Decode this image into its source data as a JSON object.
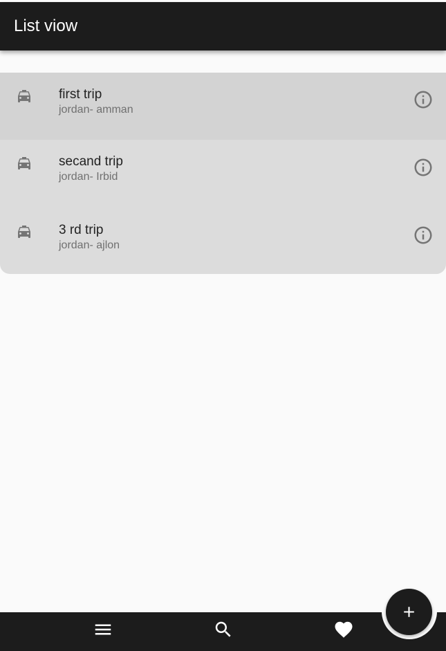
{
  "app_bar": {
    "title": "List viow"
  },
  "list": {
    "items": [
      {
        "title": "first trip",
        "subtitle": "jordan- amman",
        "leading_icon": "taxi-icon",
        "trailing_icon": "info-icon",
        "selected": true
      },
      {
        "title": "secand trip",
        "subtitle": "jordan- Irbid",
        "leading_icon": "taxi-icon",
        "trailing_icon": "info-icon",
        "selected": false
      },
      {
        "title": "3 rd trip",
        "subtitle": "jordan- ajlon",
        "leading_icon": "taxi-icon",
        "trailing_icon": "info-icon",
        "selected": false
      }
    ]
  },
  "bottom_nav": {
    "items": [
      {
        "icon": "menu-icon"
      },
      {
        "icon": "search-icon"
      },
      {
        "icon": "heart-icon"
      }
    ]
  },
  "fab": {
    "icon": "plus-icon"
  },
  "colors": {
    "app_bar": "#1c1c1c",
    "background": "#fafafa",
    "list_card": "#dcdcdc",
    "selected_row": "#d3d3d3",
    "icon_gray": "#757575"
  }
}
